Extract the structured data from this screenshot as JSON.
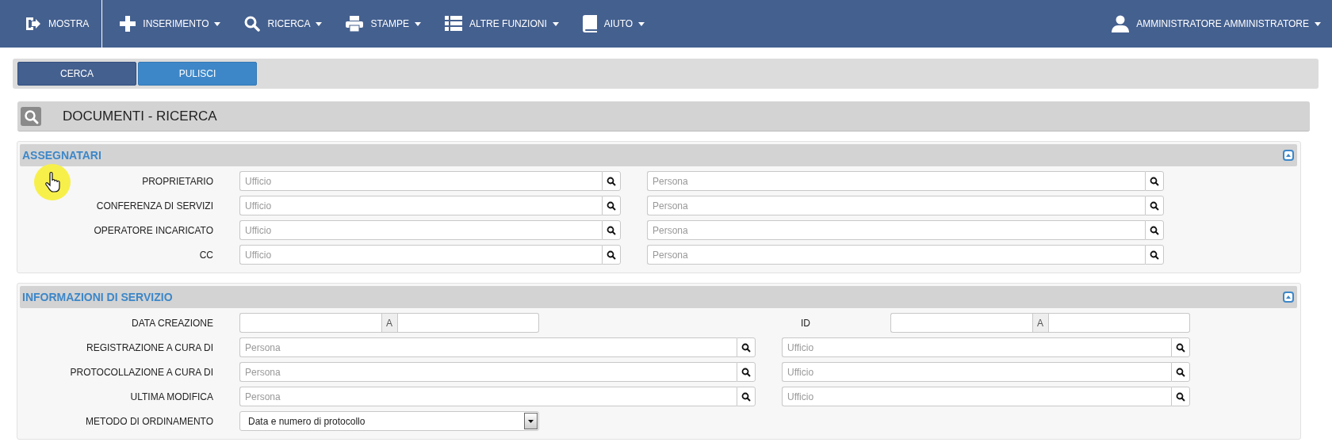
{
  "navbar": {
    "items": [
      {
        "label": "MOSTRA",
        "has_caret": false
      },
      {
        "label": "INSERIMENTO",
        "has_caret": true
      },
      {
        "label": "RICERCA",
        "has_caret": true
      },
      {
        "label": "STAMPE",
        "has_caret": true
      },
      {
        "label": "ALTRE FUNZIONI",
        "has_caret": true
      },
      {
        "label": "AIUTO",
        "has_caret": true
      }
    ],
    "user": {
      "label": "AMMINISTRATORE AMMINISTRATORE",
      "has_caret": true
    }
  },
  "toolbar": {
    "buttons": [
      {
        "label": "CERCA",
        "kind": "primary"
      },
      {
        "label": "PULISCI",
        "kind": "secondary"
      }
    ]
  },
  "page_title": "DOCUMENTI - RICERCA",
  "sections": [
    {
      "title": "ASSEGNATARI",
      "expanded": true,
      "rows": [
        {
          "kind": "lookups",
          "label": "PROPRIETARIO",
          "fields": [
            {
              "placeholder": "Ufficio"
            },
            {
              "placeholder": "Persona"
            }
          ]
        },
        {
          "kind": "lookups",
          "label": "CONFERENZA DI SERVIZI",
          "fields": [
            {
              "placeholder": "Ufficio"
            },
            {
              "placeholder": "Persona"
            }
          ]
        },
        {
          "kind": "lookups",
          "label": "OPERATORE INCARICATO",
          "fields": [
            {
              "placeholder": "Ufficio"
            },
            {
              "placeholder": "Persona"
            }
          ]
        },
        {
          "kind": "lookups",
          "label": "CC",
          "fields": [
            {
              "placeholder": "Ufficio"
            },
            {
              "placeholder": "Persona"
            }
          ]
        }
      ]
    },
    {
      "title": "INFORMAZIONI DI SERVIZIO",
      "expanded": true,
      "rows": [
        {
          "kind": "ranges",
          "label": "DATA CREAZIONE",
          "separator": "A",
          "second_label": "ID",
          "second_separator": "A"
        },
        {
          "kind": "lookups",
          "label": "REGISTRAZIONE A CURA DI",
          "fields": [
            {
              "placeholder": "Persona"
            },
            {
              "placeholder": "Ufficio"
            }
          ]
        },
        {
          "kind": "lookups",
          "label": "PROTOCOLLAZIONE A CURA DI",
          "fields": [
            {
              "placeholder": "Persona"
            },
            {
              "placeholder": "Ufficio"
            }
          ]
        },
        {
          "kind": "lookups",
          "label": "ULTIMA MODIFICA",
          "fields": [
            {
              "placeholder": "Persona"
            },
            {
              "placeholder": "Ufficio"
            }
          ]
        },
        {
          "kind": "select",
          "label": "METODO DI ORDINAMENTO",
          "value": "Data e numero di protocollo"
        }
      ]
    }
  ]
}
